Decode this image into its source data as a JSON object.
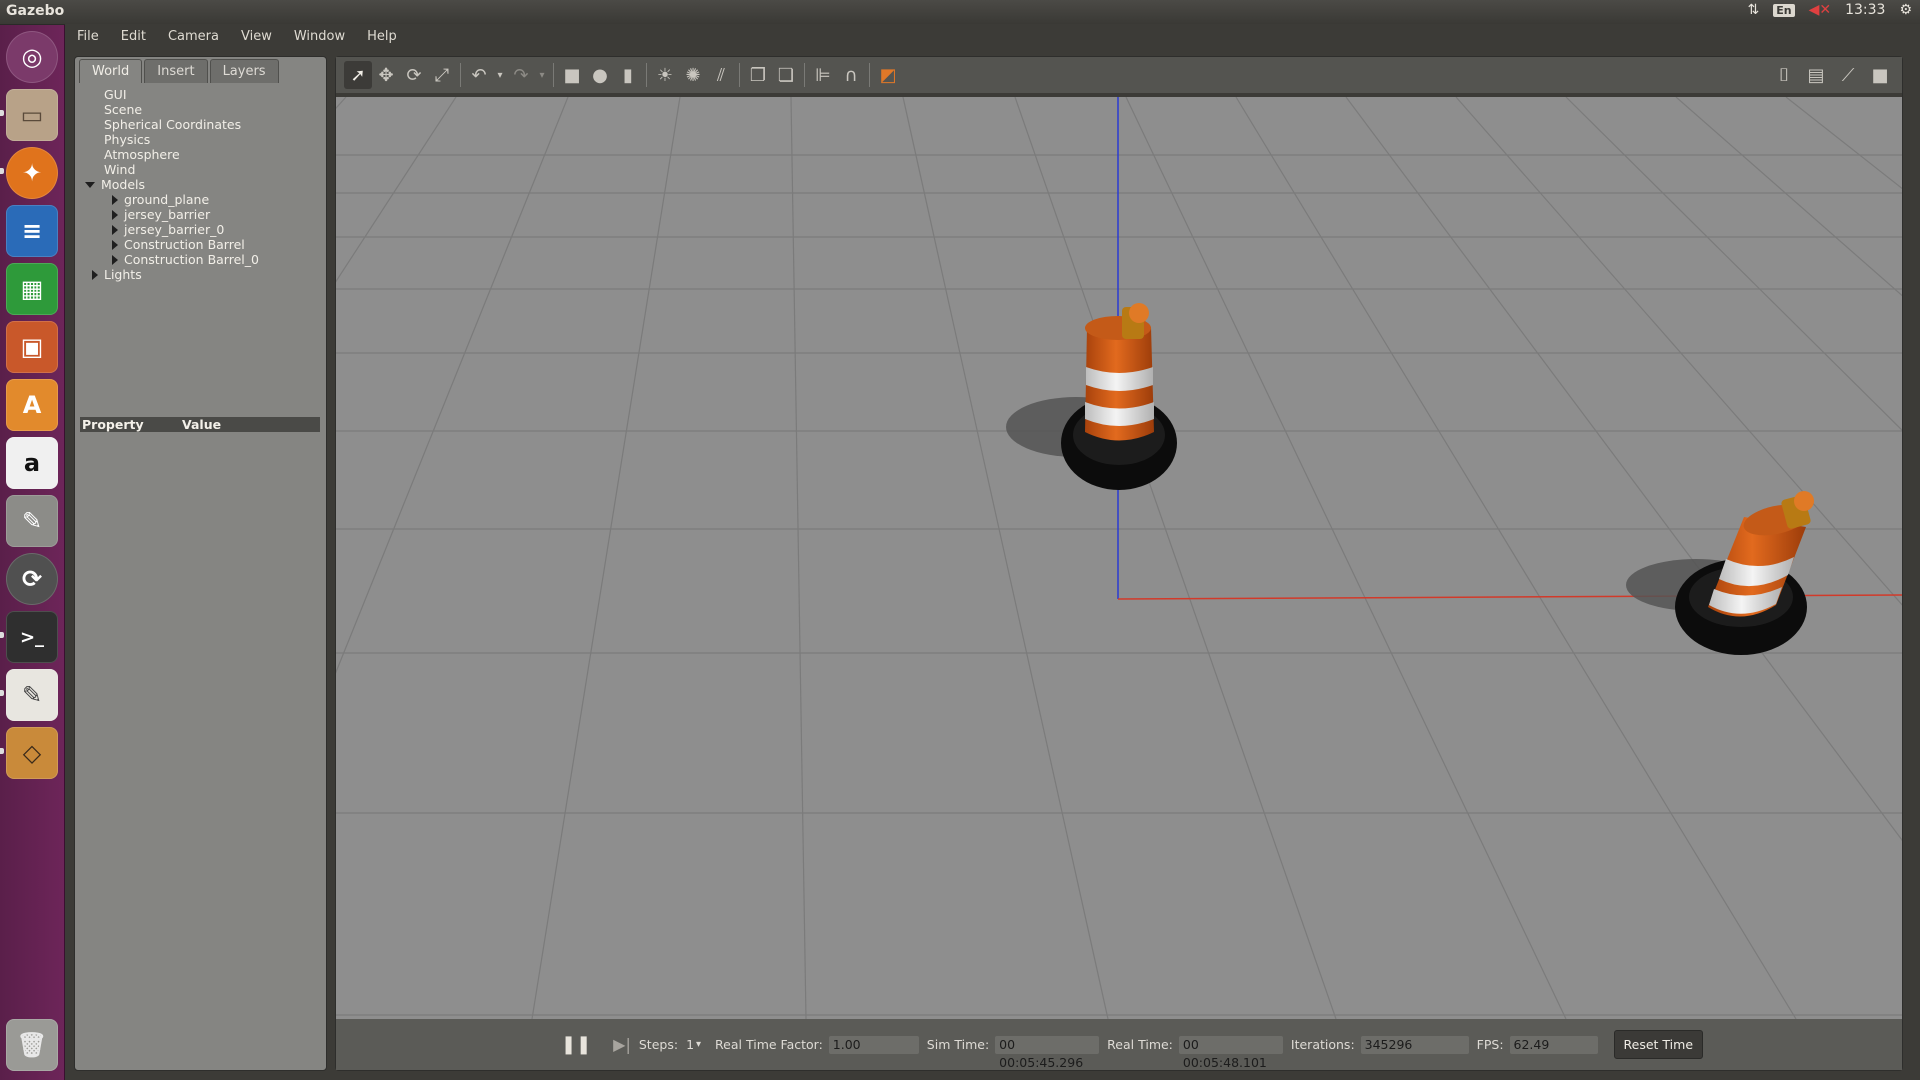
{
  "app": {
    "title": "Gazebo"
  },
  "indicators": {
    "keyboard": "En",
    "clock": "13:33"
  },
  "menu": [
    "File",
    "Edit",
    "Camera",
    "View",
    "Window",
    "Help"
  ],
  "tabs": [
    "World",
    "Insert",
    "Layers"
  ],
  "tree": {
    "top": [
      "GUI",
      "Scene",
      "Spherical Coordinates",
      "Physics",
      "Atmosphere",
      "Wind"
    ],
    "models_label": "Models",
    "models": [
      "ground_plane",
      "jersey_barrier",
      "jersey_barrier_0",
      "Construction Barrel",
      "Construction Barrel_0"
    ],
    "lights_label": "Lights"
  },
  "properties": {
    "col_property": "Property",
    "col_value": "Value"
  },
  "bottom": {
    "steps_label": "Steps:",
    "steps_value": "1",
    "rtf_label": "Real Time Factor:",
    "rtf_value": "1.00",
    "sim_label": "Sim Time:",
    "sim_value": "00 00:05:45.296",
    "real_label": "Real Time:",
    "real_value": "00 00:05:48.101",
    "iter_label": "Iterations:",
    "iter_value": "345296",
    "fps_label": "FPS:",
    "fps_value": "62.49",
    "reset_label": "Reset Time"
  },
  "launcher": [
    "ubuntu-dash-icon",
    "files-icon",
    "firefox-icon",
    "writer-icon",
    "calc-icon",
    "impress-icon",
    "software-center-icon",
    "amazon-icon",
    "system-settings-icon",
    "software-updater-icon",
    "terminal-icon",
    "text-editor-icon",
    "gazebo-icon",
    "trash-icon"
  ],
  "colors": {
    "viewport_bg": "#8e8e8e",
    "barrel_orange": "#d4601a",
    "x_axis": "#d23a2a",
    "z_axis": "#2a3ad2"
  }
}
